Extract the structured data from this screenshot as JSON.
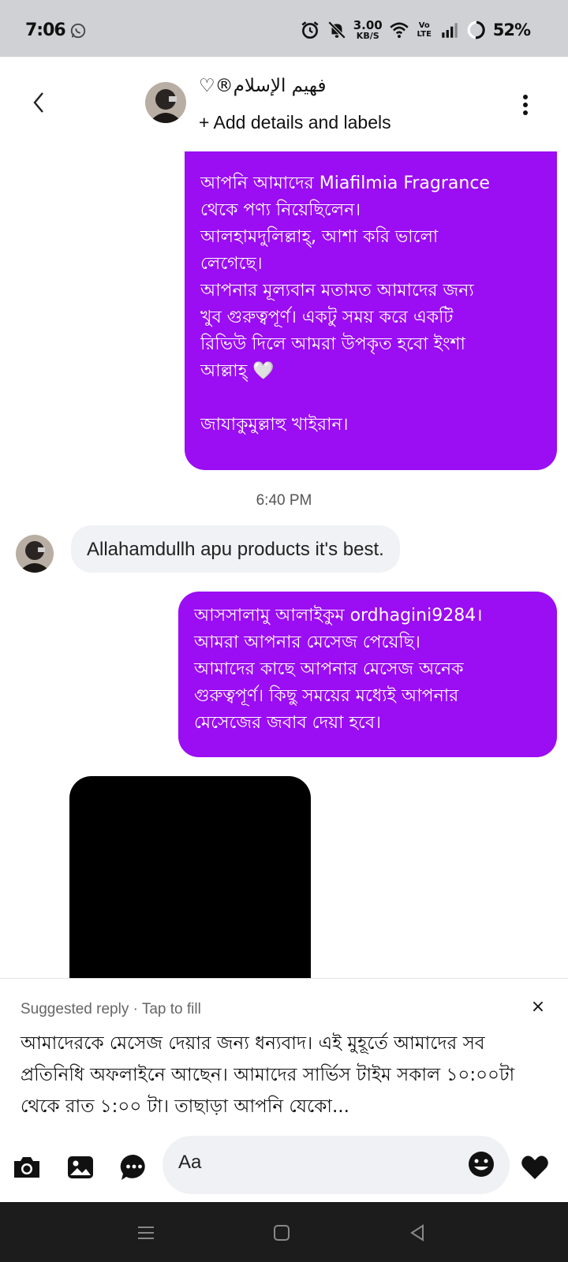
{
  "status_bar": {
    "time": "7:06",
    "net_speed_value": "3.00",
    "net_speed_unit": "KB/S",
    "volte": "Vo LTE",
    "battery": "52%"
  },
  "header": {
    "contact_name": "فهيم الإسلام®♡",
    "subtitle": "+ Add details and labels"
  },
  "messages": {
    "outgoing_1_lines": [
      "আপনি আমাদের Miafilmia Fragrance",
      "থেকে পণ্য নিয়েছিলেন।",
      "আলহামদুলিল্লাহ্, আশা করি ভালো",
      "লেগেছে।",
      "আপনার মূল্যবান মতামত আমাদের জন্য",
      "খুব গুরুত্বপূর্ণ। একটু সময় করে একটি",
      "রিভিউ দিলে আমরা উপকৃত হবো ইংশা",
      "আল্লাহ্ 🤍",
      "",
      "জাযাকুমুল্লাহু খাইরান।"
    ],
    "timestamp": "6:40 PM",
    "incoming_1": "Allahamdullh apu products it's best.",
    "outgoing_2_lines": [
      "আসসালামু আলাইকুম ordhagini9284।",
      "আমরা আপনার মেসেজ পেয়েছি।",
      "আমাদের কাছে আপনার মেসেজ অনেক",
      "গুরুত্বপূর্ণ। কিছু সময়ের মধ্যেই আপনার",
      "মেসেজের জবাব দেয়া হবে।"
    ]
  },
  "suggested_reply": {
    "label": "Suggested reply · Tap to fill",
    "close": "×",
    "text": "আমাদেরকে মেসেজ দেয়ার জন্য ধন্যবাদ। এই মুহূর্তে আমাদের সব প্রতিনিধি অফলাইনে আছেন। আমাদের সার্ভিস টাইম সকাল ১০:০০টা থেকে রাত ১:০০ টা। তাছাড়া আপনি যেকো..."
  },
  "composer": {
    "placeholder": "Aa"
  },
  "colors": {
    "outgoing_bubble": "#9b0df2",
    "incoming_bubble": "#f1f2f5",
    "status_bar_bg": "#cfd1d4",
    "nav_bar_bg": "#1c1c1c"
  },
  "icons": {
    "status": [
      "whatsapp-icon",
      "alarm-icon",
      "mute-icon",
      "wifi-icon",
      "signal-icon",
      "battery-ring-icon"
    ],
    "header": [
      "back-icon",
      "more-vertical-icon"
    ],
    "composer": [
      "camera-icon",
      "gallery-icon",
      "more-chat-icon",
      "emoji-icon",
      "heart-icon"
    ],
    "nav": [
      "recents-icon",
      "home-icon",
      "back-nav-icon"
    ]
  }
}
